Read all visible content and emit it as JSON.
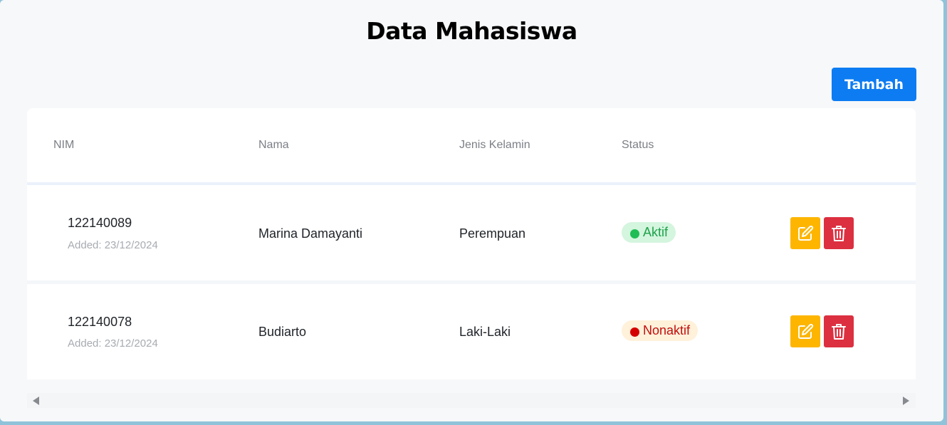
{
  "page": {
    "title": "Data Mahasiswa",
    "add_button_label": "Tambah"
  },
  "table": {
    "headers": {
      "nim": "NIM",
      "nama": "Nama",
      "jenis_kelamin": "Jenis Kelamin",
      "status": "Status"
    },
    "rows": [
      {
        "nim": "122140089",
        "added": "Added: 23/12/2024",
        "nama": "Marina Damayanti",
        "jenis_kelamin": "Perempuan",
        "status": "Aktif",
        "status_type": "active"
      },
      {
        "nim": "122140078",
        "added": "Added: 23/12/2024",
        "nama": "Budiarto",
        "jenis_kelamin": "Laki-Laki",
        "status": "Nonaktif",
        "status_type": "inactive"
      }
    ]
  },
  "actions": {
    "edit_icon": "edit-icon",
    "delete_icon": "trash-icon"
  },
  "colors": {
    "primary": "#0d7cf2",
    "edit": "#fdb500",
    "delete": "#dc3040",
    "active_text": "#1ea24b",
    "inactive_text": "#c20e0e"
  }
}
